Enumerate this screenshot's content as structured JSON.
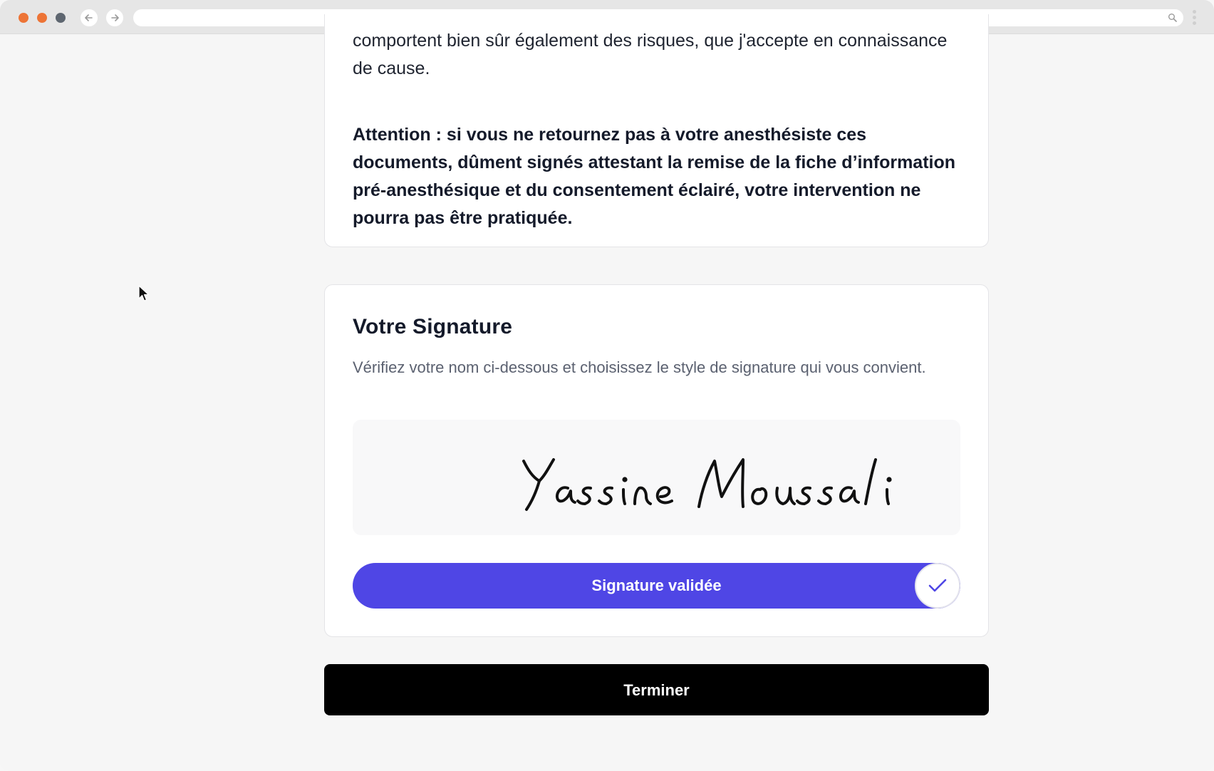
{
  "consent": {
    "body_text": "comportent bien sûr également des risques, que j'accepte en connaissance de cause.",
    "warning_text": "Attention : si vous ne retournez pas à votre anesthésiste ces documents, dûment signés attestant la remise de la fiche d’information pré-anesthésique et du consentement éclairé, votre intervention ne pourra pas être pratiquée."
  },
  "signature": {
    "title": "Votre Signature",
    "description": "Vérifiez votre nom ci-dessous et choisissez le style de signature qui vous convient.",
    "name": "Yassine Moussali",
    "status_label": "Signature validée"
  },
  "actions": {
    "finish_label": "Terminer"
  },
  "colors": {
    "accent": "#4f46e5",
    "finish_button": "#000000",
    "dot_orange": "#ed7436",
    "dot_gray": "#5e6670"
  },
  "icons": {
    "back": "arrow-left-icon",
    "forward": "arrow-right-icon",
    "search": "search-icon",
    "menu": "kebab-menu-icon",
    "check": "check-icon",
    "cursor": "mouse-pointer-icon"
  }
}
